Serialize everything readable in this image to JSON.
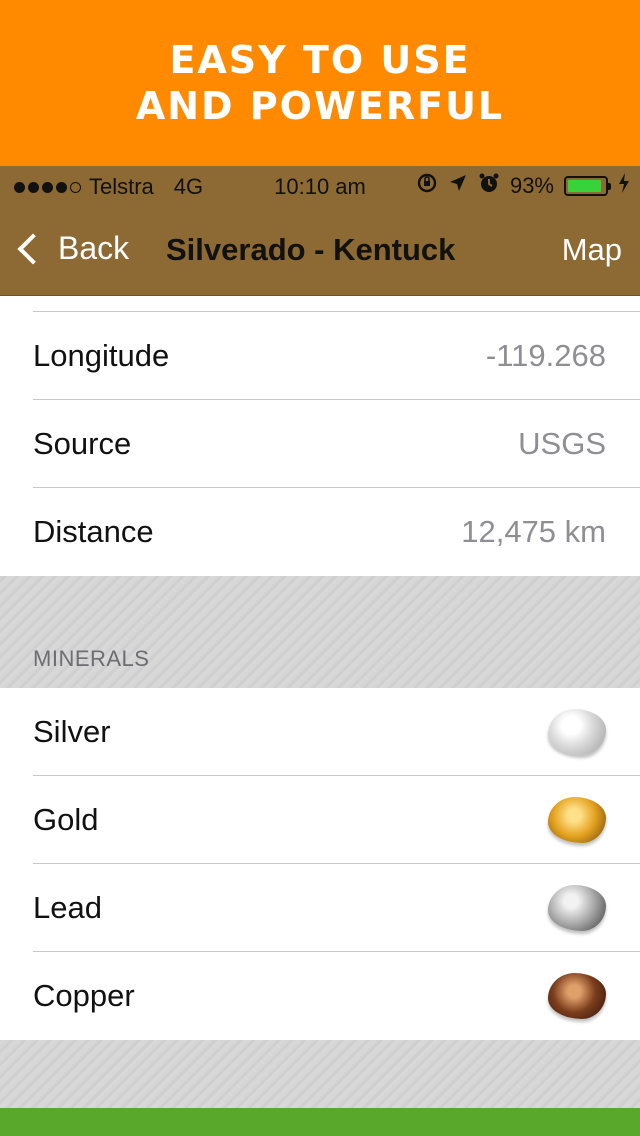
{
  "promo": {
    "line1": "EASY TO USE",
    "line2": "AND POWERFUL"
  },
  "status_bar": {
    "carrier": "Telstra",
    "network": "4G",
    "time": "10:10 am",
    "battery": "93%",
    "signal_bars_filled": 4,
    "signal_bars_total": 5
  },
  "nav": {
    "back_label": "Back",
    "title": "Silverado - Kentuck",
    "right_label": "Map"
  },
  "details": [
    {
      "label": "Longitude",
      "value": "-119.268"
    },
    {
      "label": "Source",
      "value": "USGS"
    },
    {
      "label": "Distance",
      "value": "12,475 km"
    }
  ],
  "minerals_header": "MINERALS",
  "minerals": [
    {
      "label": "Silver",
      "icon": "silver-nugget-icon"
    },
    {
      "label": "Gold",
      "icon": "gold-nugget-icon"
    },
    {
      "label": "Lead",
      "icon": "lead-nugget-icon"
    },
    {
      "label": "Copper",
      "icon": "copper-nugget-icon"
    }
  ],
  "colors": {
    "promo": "#ff8a00",
    "nav_bar": "#8d6a33",
    "bottom_bar": "#5aa82b",
    "battery": "#36d43a"
  }
}
